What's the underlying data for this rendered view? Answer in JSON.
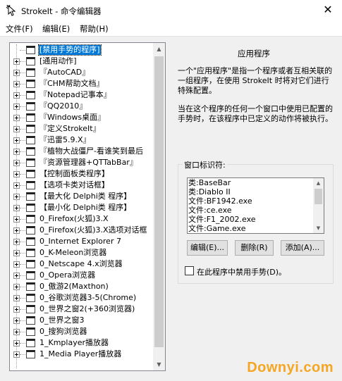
{
  "window": {
    "title": "StrokeIt - 命令编辑器",
    "close_glyph": "✕"
  },
  "menu": [
    "文件(F)",
    "编辑(E)",
    "帮助(H)"
  ],
  "tree": {
    "items": [
      {
        "label": "[禁用手势的程序]",
        "selected": true,
        "expander": false
      },
      {
        "label": "[通用动作]",
        "expander": true
      },
      {
        "label": "『AutoCAD』",
        "expander": true
      },
      {
        "label": "『CHM帮助文档』",
        "expander": true
      },
      {
        "label": "『Notepad记事本』",
        "expander": true
      },
      {
        "label": "『QQ2010』",
        "expander": true
      },
      {
        "label": "『Windows桌面』",
        "expander": true
      },
      {
        "label": "『定义StrokeIt』",
        "expander": true
      },
      {
        "label": "『迅雷5.9.X』",
        "expander": true
      },
      {
        "label": "『植物大战僵尸-看谁笑到最后",
        "expander": true
      },
      {
        "label": "『资源管理器+QTTabBar』",
        "expander": true
      },
      {
        "label": "【控制面板类程序】",
        "expander": true
      },
      {
        "label": "【选项卡类对话框】",
        "expander": true
      },
      {
        "label": "【最大化 Delphi类 程序】",
        "expander": true
      },
      {
        "label": "【最小化 Delphi类 程序】",
        "expander": true
      },
      {
        "label": "0_Firefox(火狐)3.X",
        "expander": true
      },
      {
        "label": "0_Firefox(火狐)3.X选项对话框",
        "expander": true
      },
      {
        "label": "0_Internet Explorer 7",
        "expander": true
      },
      {
        "label": "0_K-Meleon浏览器",
        "expander": true
      },
      {
        "label": "0_Netscape 4.x浏览器",
        "expander": true
      },
      {
        "label": "0_Opera浏览器",
        "expander": true
      },
      {
        "label": "0_傲游2(Maxthon)",
        "expander": true
      },
      {
        "label": "0_谷歌浏览器3-5(Chrome)",
        "expander": true
      },
      {
        "label": "0_世界之窗2(+360浏览器)",
        "expander": true
      },
      {
        "label": "0_世界之窗3",
        "expander": true
      },
      {
        "label": "0_搜狗浏览器",
        "expander": true
      },
      {
        "label": "1_Kmplayer播放器",
        "expander": true
      },
      {
        "label": "1_Media Player播放器",
        "expander": true
      }
    ]
  },
  "right": {
    "title": "应用程序",
    "desc1": "一个\"应用程序\"是指一个程序或者互相关联的一组程序，在使用 StrokeIt 时将对它们进行特殊配置。",
    "desc2": "当在这个程序的任何一个窗口中使用已配置的手势时，在该程序中已定义的动作将被执行。",
    "group_label": "窗口标识符:",
    "window_ids": [
      "类:BaseBar",
      "类:Diablo II",
      "文件:BF1942.exe",
      "文件:ce.exe",
      "文件:F1_2002.exe",
      "文件:Game.exe"
    ],
    "buttons": {
      "edit": "编辑(E)...",
      "delete": "删除(R)",
      "add": "添加(A)..."
    },
    "checkbox_label": "在此程序中禁用手势(D)。",
    "checkbox_checked": false
  },
  "watermark": "Downyi.com"
}
